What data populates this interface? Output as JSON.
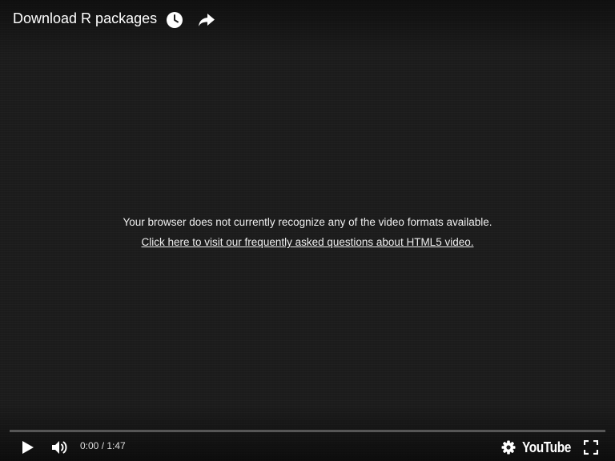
{
  "header": {
    "title": "Download R packages",
    "watch_later_icon": "clock-icon",
    "share_icon": "share-arrow-icon"
  },
  "message": {
    "line1": "Your browser does not currently recognize any of the video formats available.",
    "link": "Click here to visit our frequently asked questions about HTML5 video."
  },
  "controls": {
    "play_icon": "play-icon",
    "volume_icon": "volume-icon",
    "time_display": "0:00 / 1:47",
    "settings_icon": "gear-icon",
    "logo_text": "YouTube",
    "fullscreen_icon": "fullscreen-icon",
    "progress": 0
  },
  "colors": {
    "background": "#1c1c1c",
    "text": "#eeeeee",
    "progress_track": "#5a5a5a"
  }
}
